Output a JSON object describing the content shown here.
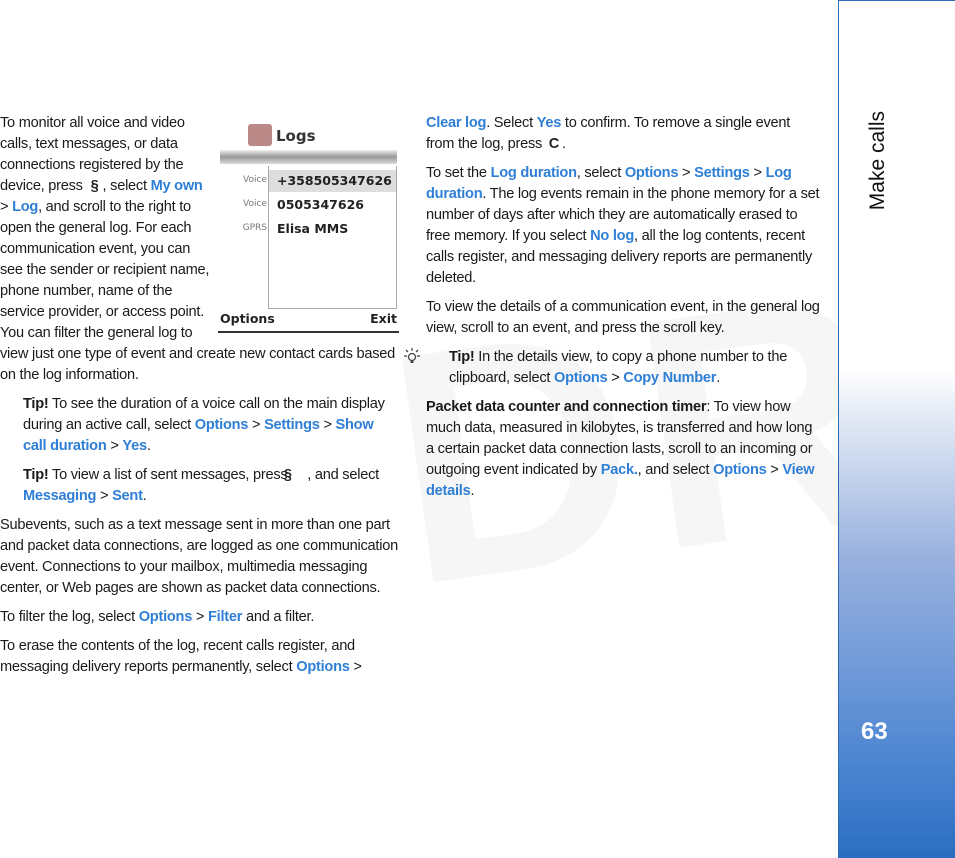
{
  "sidebar": {
    "chapter_title": "Make calls",
    "page_number": "63"
  },
  "watermark": "DRAFT",
  "phone_screen": {
    "title": "Logs",
    "rows": [
      {
        "type": "Voice",
        "value": "+358505347626"
      },
      {
        "type": "Voice",
        "value": "0505347626"
      },
      {
        "type": "GPRS",
        "value": "Elisa MMS"
      }
    ],
    "left_softkey": "Options",
    "right_softkey": "Exit"
  },
  "colors": {
    "link": "#2f7fd6",
    "sidebar_blue": "#2a6dc0"
  },
  "left_column": [
    {
      "kind": "p",
      "segments": [
        [
          "To monitor all voice and video calls, text messages, or data connections registered by the device, press ",
          ""
        ],
        [
          "menu-key-icon",
          "icon"
        ],
        [
          ", select ",
          ""
        ],
        [
          "My own",
          "l"
        ],
        [
          " > ",
          ""
        ],
        [
          "Log",
          "l"
        ],
        [
          ", and scroll to the right to open the general log. For each communication event, you can see the sender or recipient name, phone number, name of the service provider, or access point. You can filter the general log to view just one type of event and create new contact cards based on the log information.",
          ""
        ]
      ]
    },
    {
      "kind": "tip",
      "segments": [
        [
          "Tip!",
          "b"
        ],
        [
          " To see the duration of a voice call on the main display during an active call, select ",
          ""
        ],
        [
          "Options",
          "l"
        ],
        [
          " > ",
          ""
        ],
        [
          "Settings",
          "l"
        ],
        [
          " > ",
          ""
        ],
        [
          "Show call duration",
          "l"
        ],
        [
          " > ",
          ""
        ],
        [
          "Yes",
          "l"
        ],
        [
          ".",
          ""
        ]
      ]
    },
    {
      "kind": "tip",
      "segments": [
        [
          "Tip!",
          "b"
        ],
        [
          " To view a list of sent messages, press ",
          ""
        ],
        [
          "menu-key-icon",
          "icon"
        ],
        [
          ", and select ",
          ""
        ],
        [
          "Messaging",
          "l"
        ],
        [
          " > ",
          ""
        ],
        [
          "Sent",
          "l"
        ],
        [
          ".",
          ""
        ]
      ]
    },
    {
      "kind": "p",
      "segments": [
        [
          "Subevents, such as a text message sent in more than one part and packet data connections, are logged as one communication event. Connections to your mailbox, multimedia messaging center, or Web pages are shown as packet data connections.",
          ""
        ]
      ]
    },
    {
      "kind": "p",
      "segments": [
        [
          "To filter the log, select ",
          ""
        ],
        [
          "Options",
          "l"
        ],
        [
          " > ",
          ""
        ],
        [
          "Filter",
          "l"
        ],
        [
          " and a filter.",
          ""
        ]
      ]
    },
    {
      "kind": "p",
      "segments": [
        [
          "To erase the contents of the log, recent calls register, and messaging delivery reports permanently, select ",
          ""
        ],
        [
          "Options",
          "l"
        ],
        [
          " >",
          ""
        ]
      ]
    }
  ],
  "right_column": [
    {
      "kind": "p",
      "segments": [
        [
          "Clear log",
          "l"
        ],
        [
          ". Select ",
          ""
        ],
        [
          "Yes",
          "l"
        ],
        [
          " to confirm. To remove a single event from the log, press ",
          ""
        ],
        [
          "clear-key-icon",
          "icon"
        ],
        [
          ".",
          ""
        ]
      ]
    },
    {
      "kind": "p",
      "segments": [
        [
          "To set the ",
          ""
        ],
        [
          "Log duration",
          "l"
        ],
        [
          ", select ",
          ""
        ],
        [
          "Options",
          "l"
        ],
        [
          " > ",
          ""
        ],
        [
          "Settings",
          "l"
        ],
        [
          " > ",
          ""
        ],
        [
          "Log duration",
          "l"
        ],
        [
          ". The log events remain in the phone memory for a set number of days after which they are automatically erased to free memory. If you select ",
          ""
        ],
        [
          "No log",
          "l"
        ],
        [
          ", all the log contents, recent calls register, and messaging delivery reports are permanently deleted.",
          ""
        ]
      ]
    },
    {
      "kind": "p",
      "segments": [
        [
          "To view the details of a communication event, in the general log view, scroll to an event, and press the scroll key.",
          ""
        ]
      ]
    },
    {
      "kind": "tip",
      "segments": [
        [
          "Tip!",
          "b"
        ],
        [
          " In the details view, to copy a phone number to the clipboard, select ",
          ""
        ],
        [
          "Options",
          "l"
        ],
        [
          " > ",
          ""
        ],
        [
          "Copy Number",
          "l"
        ],
        [
          ".",
          ""
        ]
      ]
    },
    {
      "kind": "p",
      "segments": [
        [
          "Packet data counter and connection timer",
          "b"
        ],
        [
          ": To view how much data, measured in kilobytes, is transferred and how long a certain packet data connection lasts, scroll to an incoming or outgoing event indicated by ",
          ""
        ],
        [
          "Pack.",
          "l"
        ],
        [
          ", and select ",
          ""
        ],
        [
          "Options",
          "l"
        ],
        [
          " > ",
          ""
        ],
        [
          "View details",
          "l"
        ],
        [
          ".",
          ""
        ]
      ]
    }
  ]
}
